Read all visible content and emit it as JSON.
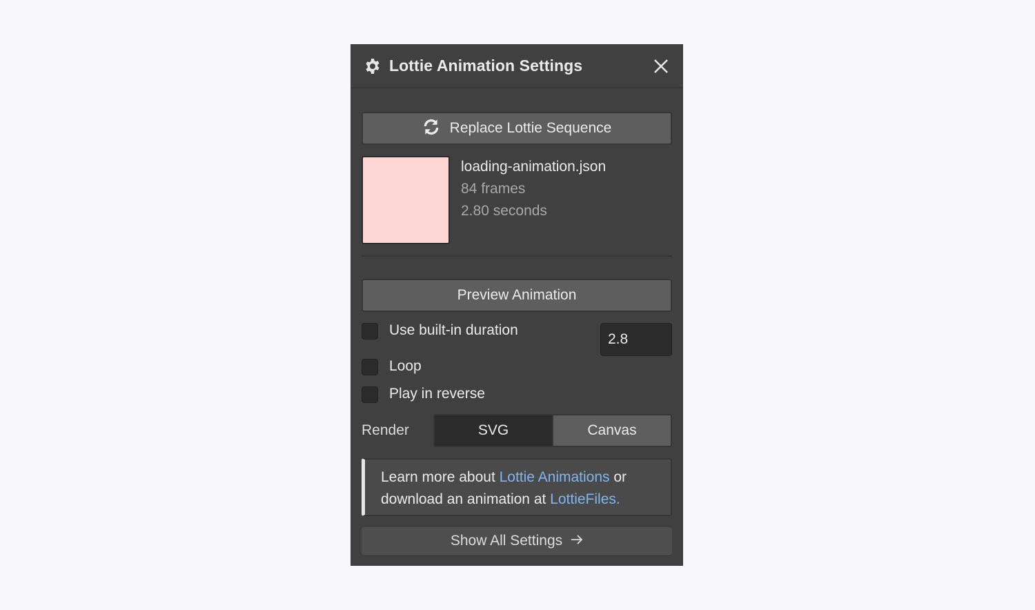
{
  "panel": {
    "title": "Lottie Animation Settings",
    "icon": "gear-icon",
    "close_icon": "close-icon"
  },
  "replace_button": {
    "label": "Replace Lottie Sequence",
    "icon": "sync-icon"
  },
  "file": {
    "name": "loading-animation.json",
    "frames": "84 frames",
    "duration": "2.80 seconds",
    "thumbnail_color": "#ffd6d6"
  },
  "preview_button": {
    "label": "Preview Animation"
  },
  "options": {
    "use_builtin_duration": {
      "label": "Use built-in duration",
      "checked": false
    },
    "loop": {
      "label": "Loop",
      "checked": false
    },
    "play_reverse": {
      "label": "Play in reverse",
      "checked": false
    },
    "duration_value": "2.8"
  },
  "render": {
    "label": "Render",
    "options": [
      "SVG",
      "Canvas"
    ],
    "selected": "SVG"
  },
  "info": {
    "text_before": "Learn more about ",
    "link1": "Lottie Animations",
    "text_middle": " or download an animation at ",
    "link2": "LottieFiles.",
    "link_color": "#7fb6f2"
  },
  "show_all": {
    "label": "Show All Settings",
    "icon": "arrow-right-icon"
  }
}
